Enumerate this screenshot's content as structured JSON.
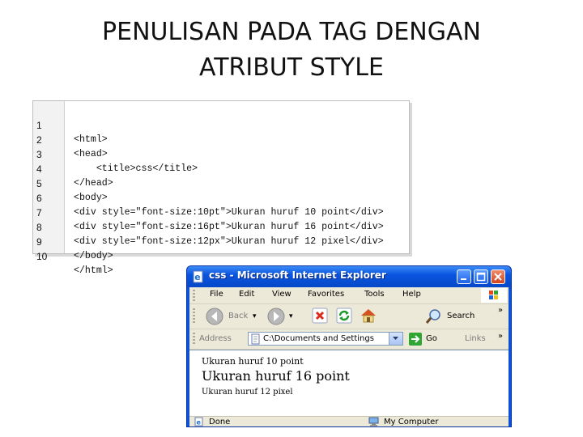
{
  "slide": {
    "title_line1": "PENULISAN PADA TAG DENGAN",
    "title_line2": "ATRIBUT STYLE"
  },
  "code_listing": [
    {
      "n": "1",
      "code": "<html>"
    },
    {
      "n": "2",
      "code": "<head>"
    },
    {
      "n": "3",
      "code": "    <title>css</title>"
    },
    {
      "n": "4",
      "code": "</head>"
    },
    {
      "n": "5",
      "code": "<body>"
    },
    {
      "n": "6",
      "code": "<div style=\"font-size:10pt\">Ukuran huruf 10 point</div>"
    },
    {
      "n": "7",
      "code": "<div style=\"font-size:16pt\">Ukuran huruf 16 point</div>"
    },
    {
      "n": "8",
      "code": "<div style=\"font-size:12px\">Ukuran huruf 12 pixel</div>"
    },
    {
      "n": "9",
      "code": "</body>"
    },
    {
      "n": "10",
      "code": "</html>"
    }
  ],
  "browser": {
    "window_title": "css - Microsoft Internet Explorer",
    "menu": [
      "File",
      "Edit",
      "View",
      "Favorites",
      "Tools",
      "Help"
    ],
    "toolbar": {
      "back_label": "Back",
      "search_label": "Search",
      "more": "»"
    },
    "address": {
      "label": "Address",
      "value": "C:\\Documents and Settings",
      "go_label": "Go",
      "links_label": "Links",
      "more": "»"
    },
    "content": [
      "Ukuran huruf 10 point",
      "Ukuran huruf 16 point",
      "Ukuran huruf 12 pixel"
    ],
    "status": {
      "left": "Done",
      "zone": "My Computer"
    }
  },
  "colors": {
    "titlebar": "#0a55df",
    "chrome": "#ece9d8",
    "back_arrow": "#9a9a9a",
    "go_arrow": "#1c9a2a"
  }
}
